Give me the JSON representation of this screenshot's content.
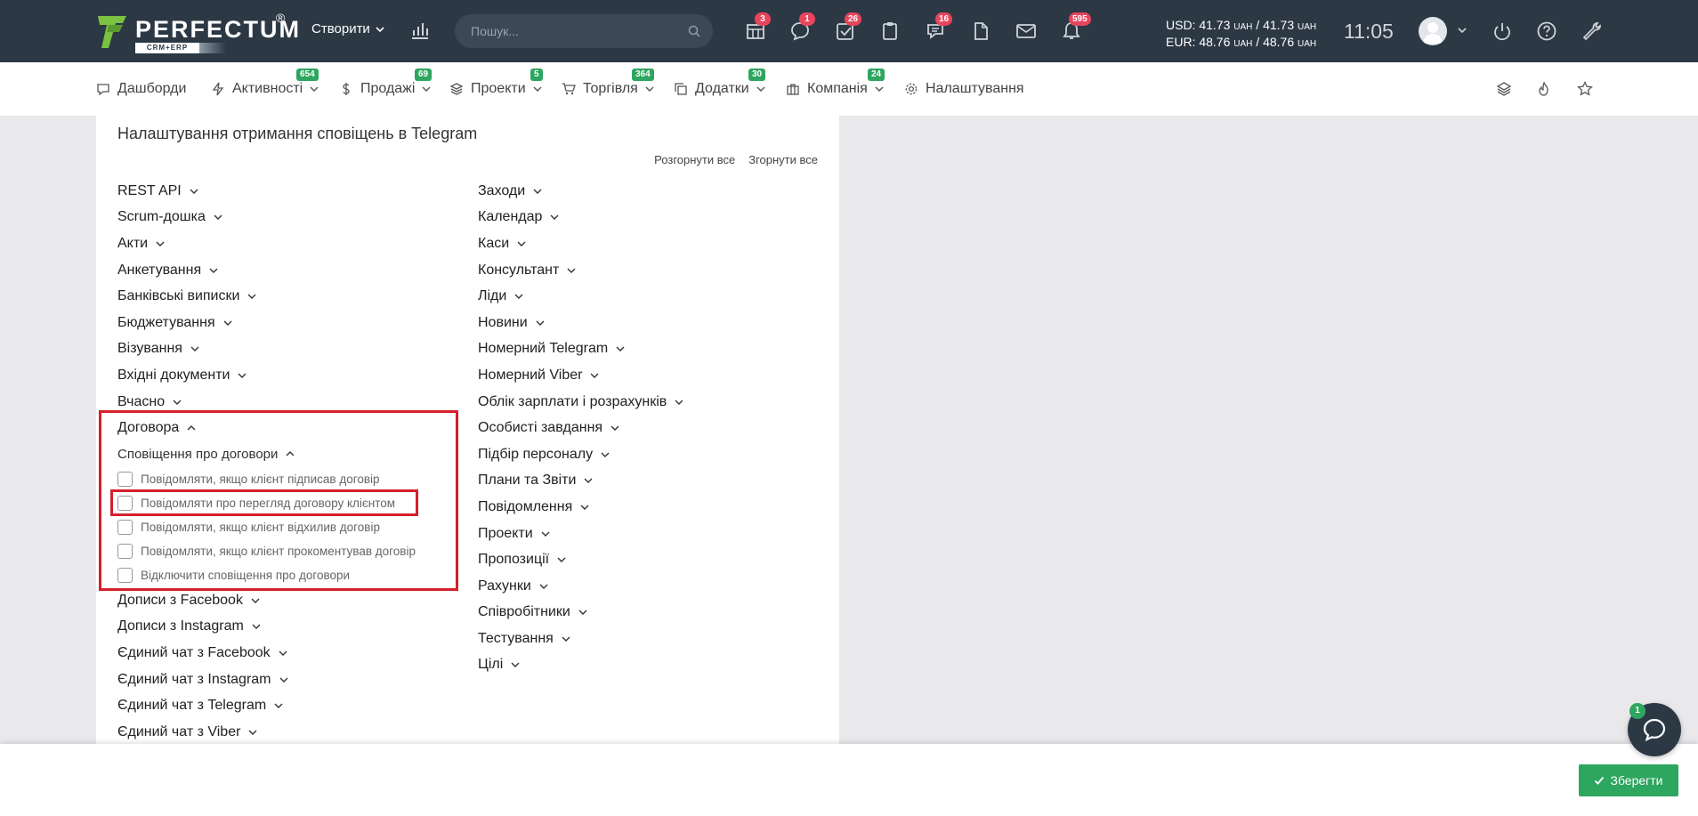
{
  "header": {
    "logo_text": "PERFECTUM",
    "logo_reg": "®",
    "logo_sub": "CRM+ERP",
    "create_label": "Створити",
    "search_placeholder": "Пошук...",
    "icon_badges": [
      {
        "icon": "tasks-board-icon",
        "count": "3"
      },
      {
        "icon": "chat-icon",
        "count": "1"
      },
      {
        "icon": "checklist-icon",
        "count": "26"
      },
      {
        "icon": "clipboard-icon",
        "count": ""
      },
      {
        "icon": "comments-icon",
        "count": "16"
      },
      {
        "icon": "document-icon",
        "count": ""
      },
      {
        "icon": "mail-icon",
        "count": ""
      },
      {
        "icon": "bell-icon",
        "count": "595"
      }
    ],
    "usd_label": "USD:",
    "usd_value": "41.73",
    "usd_value2": "41.73",
    "eur_label": "EUR:",
    "eur_value": "48.76",
    "eur_value2": "48.76",
    "currency_unit": "UAH",
    "clock": "11:05"
  },
  "nav": {
    "items": [
      {
        "label": "Дашборди",
        "badge": ""
      },
      {
        "label": "Активності",
        "badge": "654"
      },
      {
        "label": "Продажі",
        "badge": "69"
      },
      {
        "label": "Проекти",
        "badge": "5"
      },
      {
        "label": "Торгівля",
        "badge": "364"
      },
      {
        "label": "Додатки",
        "badge": "30"
      },
      {
        "label": "Компанія",
        "badge": "24"
      },
      {
        "label": "Налаштування",
        "badge": ""
      }
    ]
  },
  "panel": {
    "title": "Налаштування отримання сповіщень в Telegram",
    "expand_all": "Розгорнути все",
    "collapse_all": "Згорнути все",
    "left_before": [
      "REST API",
      "Scrum-дошка",
      "Акти",
      "Анкетування",
      "Банківські виписки",
      "Бюджетування",
      "Візування",
      "Вхідні документи",
      "Вчасно"
    ],
    "expanded_category": "Договора",
    "subcategory": "Сповіщення про договори",
    "options": [
      "Повідомляти, якщо клієнт підписав договір",
      "Повідомляти про перегляд договору клієнтом",
      "Повідомляти, якщо клієнт відхилив договір",
      "Повідомляти, якщо клієнт прокоментував договір",
      "Відключити сповіщення про договори"
    ],
    "left_after": [
      "Дописи з Facebook",
      "Дописи з Instagram",
      "Єдиний чат з Facebook",
      "Єдиний чат з Instagram",
      "Єдиний чат з Telegram",
      "Єдиний чат з Viber"
    ],
    "right": [
      "Заходи",
      "Календар",
      "Каси",
      "Консультант",
      "Ліди",
      "Новини",
      "Номерний Telegram",
      "Номерний Viber",
      "Облік зарплати і розрахунків",
      "Особисті завдання",
      "Підбір персоналу",
      "Плани та Звіти",
      "Повідомлення",
      "Проекти",
      "Пропозиції",
      "Рахунки",
      "Співробітники",
      "Тестування",
      "Цілі"
    ]
  },
  "footer": {
    "save_label": "Зберегти",
    "chat_badge": "1"
  },
  "colors": {
    "header_bg": "#2d3845",
    "accent_green": "#2da65f",
    "badge_red": "#e8455d",
    "highlight_red": "#d5202b"
  }
}
